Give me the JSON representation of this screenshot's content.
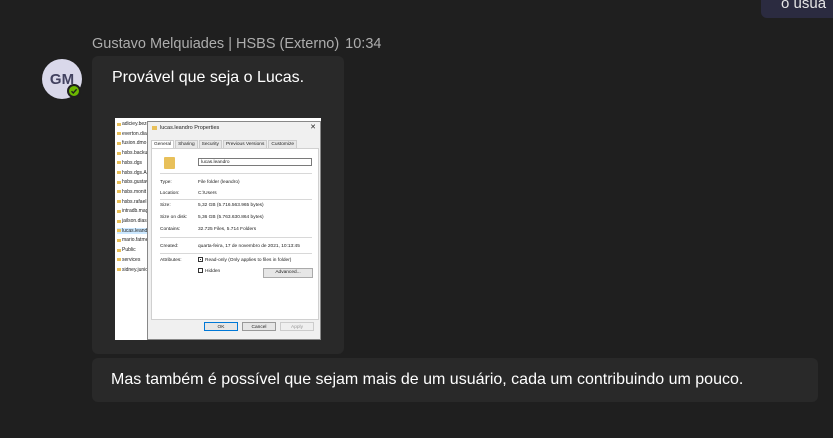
{
  "previous_message": {
    "text": "o usua"
  },
  "sender": {
    "name": "Gustavo Melquiades | HSBS (Externo)",
    "time": "10:34",
    "initials": "GM",
    "presence_color": "#6bb700"
  },
  "messages": [
    {
      "text": "Provável que seja o Lucas."
    },
    {
      "text": "Mas também é possível que sejam mais de um usuário, cada um contribuindo um pouco."
    }
  ],
  "screenshot": {
    "explorer_items": [
      "adiciey.bezer",
      "everton.dias",
      "fusion.dmo",
      "hsbs.backup",
      "hsbs.dgs",
      "hsbs.dgs.AS",
      "hsbs.gustav",
      "hsbs.monit",
      "hsbs.rafael",
      "intradb.mag",
      "jailson.dias",
      "lucas.leandr",
      "mario.fatme",
      "Public",
      "services",
      "sidney.junio"
    ],
    "selected_index": 11,
    "dialog_title": "lucas.leandro Properties",
    "close_glyph": "✕",
    "tabs": [
      "General",
      "Sharing",
      "Security",
      "Previous Versions",
      "Customize"
    ],
    "folder_name": "lucas.leandro",
    "properties": [
      {
        "label": "Type:",
        "value": "File folder (leandro)"
      },
      {
        "label": "Location:",
        "value": "C:\\Users"
      },
      {
        "label": "Size:",
        "value": "5,32 GB (5.716.563.965 bytes)"
      },
      {
        "label": "Size on disk:",
        "value": "5,36 GB (5.763.630.864 bytes)"
      },
      {
        "label": "Contains:",
        "value": "32.725 Files, 5.714 Folders"
      },
      {
        "label": "Created:",
        "value": "quarta-feira, 17 de novembro de 2021, 10:13:45"
      }
    ],
    "attributes_label": "Attributes:",
    "readonly_label": "Read-only (Only applies to files in folder)",
    "hidden_label": "Hidden",
    "advanced_label": "Advanced...",
    "ok_label": "OK",
    "cancel_label": "Cancel",
    "apply_label": "Apply"
  }
}
